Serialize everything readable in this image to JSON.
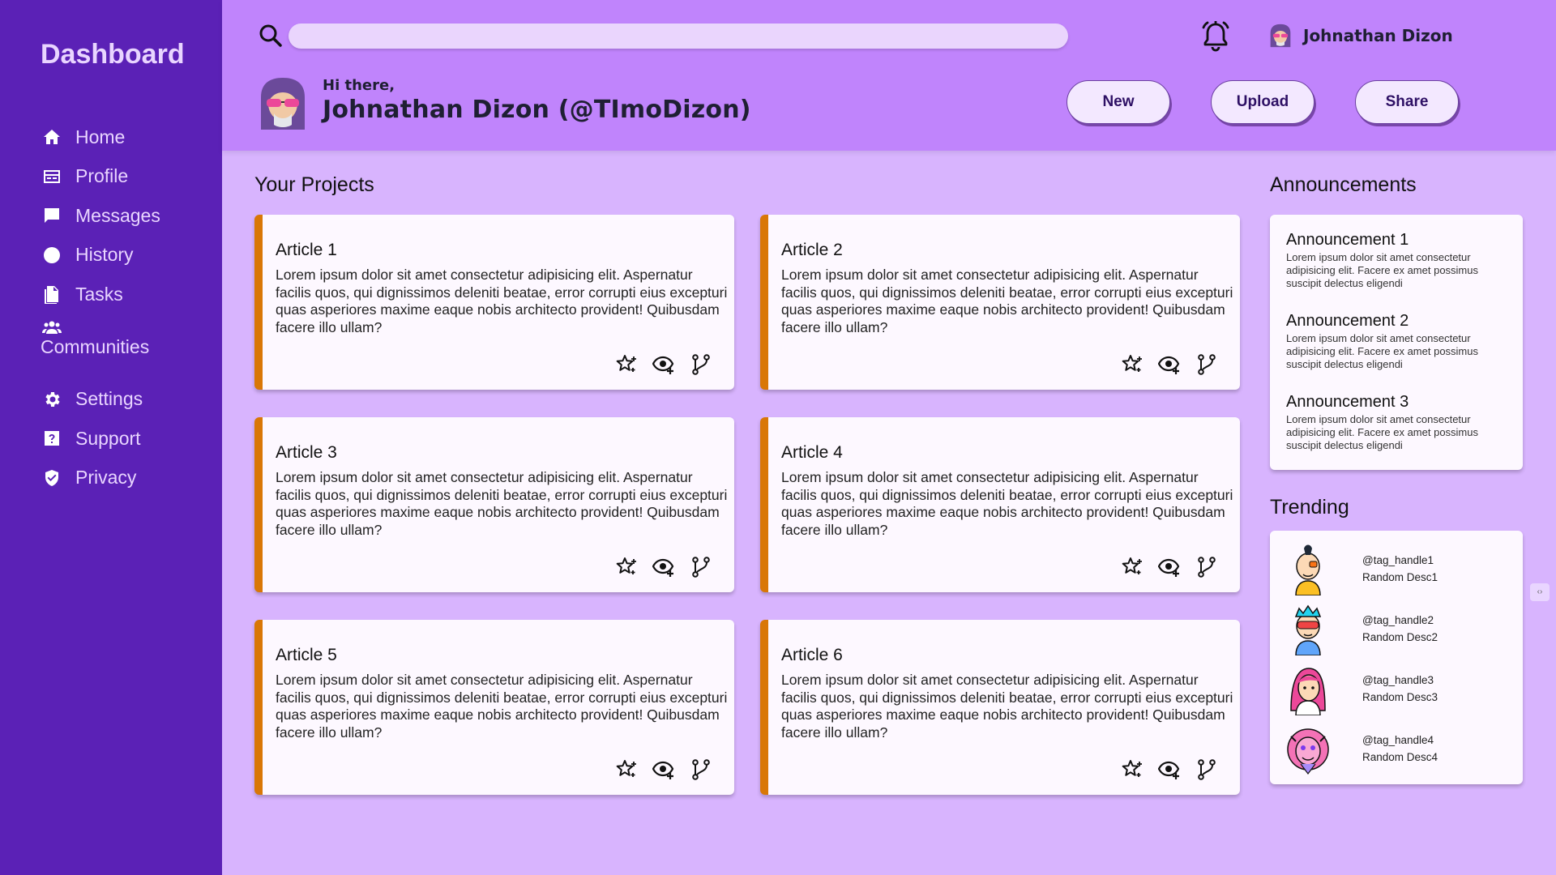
{
  "sidebar": {
    "brand": "Dashboard",
    "items": [
      {
        "label": "Home",
        "icon": "home-icon"
      },
      {
        "label": "Profile",
        "icon": "profile-card-icon"
      },
      {
        "label": "Messages",
        "icon": "chat-icon"
      },
      {
        "label": "History",
        "icon": "clock-icon"
      },
      {
        "label": "Tasks",
        "icon": "document-icon"
      },
      {
        "label": "Communities",
        "icon": "people-icon"
      },
      {
        "label": "Settings",
        "icon": "gear-icon"
      },
      {
        "label": "Support",
        "icon": "help-icon"
      },
      {
        "label": "Privacy",
        "icon": "shield-icon"
      }
    ]
  },
  "header": {
    "search_placeholder": "",
    "user_name": "Johnathan Dizon",
    "greeting": "Hi there,",
    "full_name": "Johnathan Dizon (@TImoDizon)",
    "buttons": {
      "new": "New",
      "upload": "Upload",
      "share": "Share"
    }
  },
  "projects": {
    "title": "Your Projects",
    "cards": [
      {
        "title": "Article 1",
        "body": "Lorem ipsum dolor sit amet consectetur adipisicing elit. Aspernatur facilis quos, qui dignissimos deleniti beatae, error corrupti eius excepturi quas asperiores maxime eaque nobis architecto provident! Quibusdam facere illo ullam?"
      },
      {
        "title": "Article 2",
        "body": "Lorem ipsum dolor sit amet consectetur adipisicing elit. Aspernatur facilis quos, qui dignissimos deleniti beatae, error corrupti eius excepturi quas asperiores maxime eaque nobis architecto provident! Quibusdam facere illo ullam?"
      },
      {
        "title": "Article 3",
        "body": "Lorem ipsum dolor sit amet consectetur adipisicing elit. Aspernatur facilis quos, qui dignissimos deleniti beatae, error corrupti eius excepturi quas asperiores maxime eaque nobis architecto provident! Quibusdam facere illo ullam?"
      },
      {
        "title": "Article 4",
        "body": "Lorem ipsum dolor sit amet consectetur adipisicing elit. Aspernatur facilis quos, qui dignissimos deleniti beatae, error corrupti eius excepturi quas asperiores maxime eaque nobis architecto provident! Quibusdam facere illo ullam?"
      },
      {
        "title": "Article 5",
        "body": "Lorem ipsum dolor sit amet consectetur adipisicing elit. Aspernatur facilis quos, qui dignissimos deleniti beatae, error corrupti eius excepturi quas asperiores maxime eaque nobis architecto provident! Quibusdam facere illo ullam?"
      },
      {
        "title": "Article 6",
        "body": "Lorem ipsum dolor sit amet consectetur adipisicing elit. Aspernatur facilis quos, qui dignissimos deleniti beatae, error corrupti eius excepturi quas asperiores maxime eaque nobis architecto provident! Quibusdam facere illo ullam?"
      }
    ],
    "card_actions": [
      "star-icon",
      "watch-icon",
      "fork-icon"
    ]
  },
  "announcements": {
    "title": "Announcements",
    "items": [
      {
        "title": "Announcement 1",
        "body": "Lorem ipsum dolor sit amet consectetur adipisicing elit. Facere ex amet possimus suscipit delectus eligendi"
      },
      {
        "title": "Announcement 2",
        "body": "Lorem ipsum dolor sit amet consectetur adipisicing elit. Facere ex amet possimus suscipit delectus eligendi"
      },
      {
        "title": "Announcement 3",
        "body": "Lorem ipsum dolor sit amet consectetur adipisicing elit. Facere ex amet possimus suscipit delectus eligendi"
      }
    ]
  },
  "trending": {
    "title": "Trending",
    "items": [
      {
        "handle": "@tag_handle1",
        "desc": "Random Desc1"
      },
      {
        "handle": "@tag_handle2",
        "desc": "Random Desc2"
      },
      {
        "handle": "@tag_handle3",
        "desc": "Random Desc3"
      },
      {
        "handle": "@tag_handle4",
        "desc": "Random Desc4"
      }
    ]
  },
  "colors": {
    "sidebar_bg": "#5b21b6",
    "header_bg": "#c084fc",
    "main_bg": "#d8b4fe",
    "card_accent": "#d97706",
    "card_bg": "#fdf8ff"
  }
}
